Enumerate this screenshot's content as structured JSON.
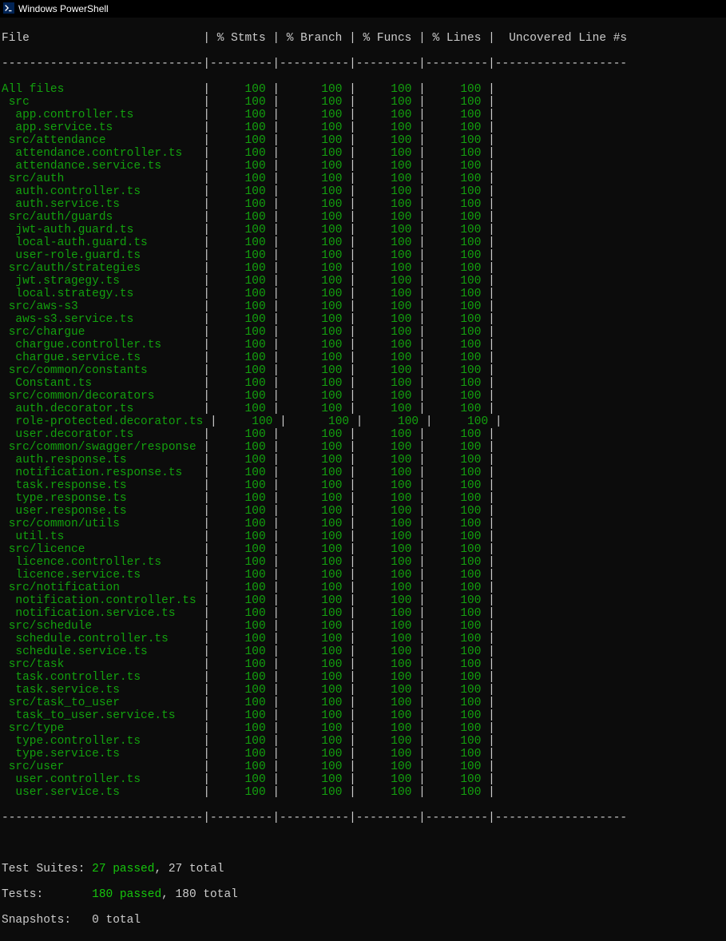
{
  "window": {
    "title": "Windows PowerShell"
  },
  "header": {
    "file": "File",
    "stmts": "% Stmts",
    "branch": "% Branch",
    "funcs": "% Funcs",
    "lines": "% Lines",
    "uncov": "Uncovered Line #s"
  },
  "separators": {
    "top": "-----------------------------|---------|----------|---------|---------|-------------------",
    "bottom": "-----------------------------|---------|----------|---------|---------|-------------------"
  },
  "rows": [
    {
      "name": "All files",
      "indent": 0,
      "stmts": "100",
      "branch": "100",
      "funcs": "100",
      "lines": "100"
    },
    {
      "name": "src",
      "indent": 1,
      "stmts": "100",
      "branch": "100",
      "funcs": "100",
      "lines": "100"
    },
    {
      "name": "app.controller.ts",
      "indent": 2,
      "stmts": "100",
      "branch": "100",
      "funcs": "100",
      "lines": "100"
    },
    {
      "name": "app.service.ts",
      "indent": 2,
      "stmts": "100",
      "branch": "100",
      "funcs": "100",
      "lines": "100"
    },
    {
      "name": "src/attendance",
      "indent": 1,
      "stmts": "100",
      "branch": "100",
      "funcs": "100",
      "lines": "100"
    },
    {
      "name": "attendance.controller.ts",
      "indent": 2,
      "stmts": "100",
      "branch": "100",
      "funcs": "100",
      "lines": "100"
    },
    {
      "name": "attendance.service.ts",
      "indent": 2,
      "stmts": "100",
      "branch": "100",
      "funcs": "100",
      "lines": "100"
    },
    {
      "name": "src/auth",
      "indent": 1,
      "stmts": "100",
      "branch": "100",
      "funcs": "100",
      "lines": "100"
    },
    {
      "name": "auth.controller.ts",
      "indent": 2,
      "stmts": "100",
      "branch": "100",
      "funcs": "100",
      "lines": "100"
    },
    {
      "name": "auth.service.ts",
      "indent": 2,
      "stmts": "100",
      "branch": "100",
      "funcs": "100",
      "lines": "100"
    },
    {
      "name": "src/auth/guards",
      "indent": 1,
      "stmts": "100",
      "branch": "100",
      "funcs": "100",
      "lines": "100"
    },
    {
      "name": "jwt-auth.guard.ts",
      "indent": 2,
      "stmts": "100",
      "branch": "100",
      "funcs": "100",
      "lines": "100"
    },
    {
      "name": "local-auth.guard.ts",
      "indent": 2,
      "stmts": "100",
      "branch": "100",
      "funcs": "100",
      "lines": "100"
    },
    {
      "name": "user-role.guard.ts",
      "indent": 2,
      "stmts": "100",
      "branch": "100",
      "funcs": "100",
      "lines": "100"
    },
    {
      "name": "src/auth/strategies",
      "indent": 1,
      "stmts": "100",
      "branch": "100",
      "funcs": "100",
      "lines": "100"
    },
    {
      "name": "jwt.stragegy.ts",
      "indent": 2,
      "stmts": "100",
      "branch": "100",
      "funcs": "100",
      "lines": "100"
    },
    {
      "name": "local.strategy.ts",
      "indent": 2,
      "stmts": "100",
      "branch": "100",
      "funcs": "100",
      "lines": "100"
    },
    {
      "name": "src/aws-s3",
      "indent": 1,
      "stmts": "100",
      "branch": "100",
      "funcs": "100",
      "lines": "100"
    },
    {
      "name": "aws-s3.service.ts",
      "indent": 2,
      "stmts": "100",
      "branch": "100",
      "funcs": "100",
      "lines": "100"
    },
    {
      "name": "src/chargue",
      "indent": 1,
      "stmts": "100",
      "branch": "100",
      "funcs": "100",
      "lines": "100"
    },
    {
      "name": "chargue.controller.ts",
      "indent": 2,
      "stmts": "100",
      "branch": "100",
      "funcs": "100",
      "lines": "100"
    },
    {
      "name": "chargue.service.ts",
      "indent": 2,
      "stmts": "100",
      "branch": "100",
      "funcs": "100",
      "lines": "100"
    },
    {
      "name": "src/common/constants",
      "indent": 1,
      "stmts": "100",
      "branch": "100",
      "funcs": "100",
      "lines": "100"
    },
    {
      "name": "Constant.ts",
      "indent": 2,
      "stmts": "100",
      "branch": "100",
      "funcs": "100",
      "lines": "100"
    },
    {
      "name": "src/common/decorators",
      "indent": 1,
      "stmts": "100",
      "branch": "100",
      "funcs": "100",
      "lines": "100"
    },
    {
      "name": "auth.decorator.ts",
      "indent": 2,
      "stmts": "100",
      "branch": "100",
      "funcs": "100",
      "lines": "100"
    },
    {
      "name": "role-protected.decorator.ts",
      "indent": 2,
      "stmts": "100",
      "branch": "100",
      "funcs": "100",
      "lines": "100"
    },
    {
      "name": "user.decorator.ts",
      "indent": 2,
      "stmts": "100",
      "branch": "100",
      "funcs": "100",
      "lines": "100"
    },
    {
      "name": "src/common/swagger/response",
      "indent": 1,
      "stmts": "100",
      "branch": "100",
      "funcs": "100",
      "lines": "100"
    },
    {
      "name": "auth.response.ts",
      "indent": 2,
      "stmts": "100",
      "branch": "100",
      "funcs": "100",
      "lines": "100"
    },
    {
      "name": "notification.response.ts",
      "indent": 2,
      "stmts": "100",
      "branch": "100",
      "funcs": "100",
      "lines": "100"
    },
    {
      "name": "task.response.ts",
      "indent": 2,
      "stmts": "100",
      "branch": "100",
      "funcs": "100",
      "lines": "100"
    },
    {
      "name": "type.response.ts",
      "indent": 2,
      "stmts": "100",
      "branch": "100",
      "funcs": "100",
      "lines": "100"
    },
    {
      "name": "user.response.ts",
      "indent": 2,
      "stmts": "100",
      "branch": "100",
      "funcs": "100",
      "lines": "100"
    },
    {
      "name": "src/common/utils",
      "indent": 1,
      "stmts": "100",
      "branch": "100",
      "funcs": "100",
      "lines": "100"
    },
    {
      "name": "util.ts",
      "indent": 2,
      "stmts": "100",
      "branch": "100",
      "funcs": "100",
      "lines": "100"
    },
    {
      "name": "src/licence",
      "indent": 1,
      "stmts": "100",
      "branch": "100",
      "funcs": "100",
      "lines": "100"
    },
    {
      "name": "licence.controller.ts",
      "indent": 2,
      "stmts": "100",
      "branch": "100",
      "funcs": "100",
      "lines": "100"
    },
    {
      "name": "licence.service.ts",
      "indent": 2,
      "stmts": "100",
      "branch": "100",
      "funcs": "100",
      "lines": "100"
    },
    {
      "name": "src/notification",
      "indent": 1,
      "stmts": "100",
      "branch": "100",
      "funcs": "100",
      "lines": "100"
    },
    {
      "name": "notification.controller.ts",
      "indent": 2,
      "stmts": "100",
      "branch": "100",
      "funcs": "100",
      "lines": "100"
    },
    {
      "name": "notification.service.ts",
      "indent": 2,
      "stmts": "100",
      "branch": "100",
      "funcs": "100",
      "lines": "100"
    },
    {
      "name": "src/schedule",
      "indent": 1,
      "stmts": "100",
      "branch": "100",
      "funcs": "100",
      "lines": "100"
    },
    {
      "name": "schedule.controller.ts",
      "indent": 2,
      "stmts": "100",
      "branch": "100",
      "funcs": "100",
      "lines": "100"
    },
    {
      "name": "schedule.service.ts",
      "indent": 2,
      "stmts": "100",
      "branch": "100",
      "funcs": "100",
      "lines": "100"
    },
    {
      "name": "src/task",
      "indent": 1,
      "stmts": "100",
      "branch": "100",
      "funcs": "100",
      "lines": "100"
    },
    {
      "name": "task.controller.ts",
      "indent": 2,
      "stmts": "100",
      "branch": "100",
      "funcs": "100",
      "lines": "100"
    },
    {
      "name": "task.service.ts",
      "indent": 2,
      "stmts": "100",
      "branch": "100",
      "funcs": "100",
      "lines": "100"
    },
    {
      "name": "src/task_to_user",
      "indent": 1,
      "stmts": "100",
      "branch": "100",
      "funcs": "100",
      "lines": "100"
    },
    {
      "name": "task_to_user.service.ts",
      "indent": 2,
      "stmts": "100",
      "branch": "100",
      "funcs": "100",
      "lines": "100"
    },
    {
      "name": "src/type",
      "indent": 1,
      "stmts": "100",
      "branch": "100",
      "funcs": "100",
      "lines": "100"
    },
    {
      "name": "type.controller.ts",
      "indent": 2,
      "stmts": "100",
      "branch": "100",
      "funcs": "100",
      "lines": "100"
    },
    {
      "name": "type.service.ts",
      "indent": 2,
      "stmts": "100",
      "branch": "100",
      "funcs": "100",
      "lines": "100"
    },
    {
      "name": "src/user",
      "indent": 1,
      "stmts": "100",
      "branch": "100",
      "funcs": "100",
      "lines": "100"
    },
    {
      "name": "user.controller.ts",
      "indent": 2,
      "stmts": "100",
      "branch": "100",
      "funcs": "100",
      "lines": "100"
    },
    {
      "name": "user.service.ts",
      "indent": 2,
      "stmts": "100",
      "branch": "100",
      "funcs": "100",
      "lines": "100"
    }
  ],
  "summary": {
    "suites_label": "Test Suites: ",
    "suites_passed": "27 passed",
    "suites_total": ", 27 total",
    "tests_label": "Tests:       ",
    "tests_passed": "180 passed",
    "tests_total": ", 180 total",
    "snapshots_label": "Snapshots:   ",
    "snapshots_total": "0 total"
  }
}
